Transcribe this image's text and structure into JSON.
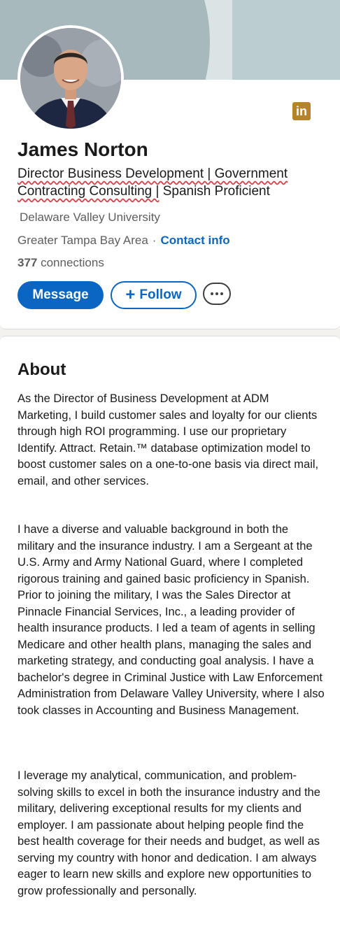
{
  "profile": {
    "name": "James Norton",
    "headline_part1": "Director Business Development | Government Contracting Consulting |",
    "headline_part2": " Spanish Proficient",
    "school": "Delaware Valley University",
    "location": "Greater Tampa Bay Area",
    "separator": "·",
    "contact_info": "Contact info",
    "connections_count": "377",
    "connections_label": " connections"
  },
  "actions": {
    "message": "Message",
    "follow_icon": "+",
    "follow": "Follow",
    "more_icon": "more-horizontal-icon"
  },
  "about": {
    "title": "About",
    "paragraphs": [
      "As the Director of Business Development at ADM Marketing, I build customer sales and loyalty for our clients through high ROI programming. I use our proprietary Identify. Attract. Retain.™ database optimization model to boost customer sales on a one-to-one basis via direct mail, email, and other services.",
      "I have a diverse and valuable background in both the military and the insurance industry. I am a Sergeant at the U.S. Army and Army National Guard, where I completed rigorous training and gained basic proficiency in Spanish. Prior to joining the military, I was the Sales Director at Pinnacle Financial Services, Inc., a leading provider of health insurance products. I led a team of agents in selling Medicare and other health plans, managing the sales and marketing strategy, and conducting goal analysis. I have a bachelor's degree in Criminal Justice with Law Enforcement Administration from Delaware Valley University, where I also took classes in Accounting and Business Management.",
      "I leverage my analytical, communication, and problem-solving skills to excel in both the insurance industry and the military, delivering exceptional results for my clients and employer. I am passionate about helping people find the best health coverage for their needs and budget, as well as serving my country with honor and dedication. I am always eager to learn new skills and explore new opportunities to grow professionally and personally."
    ]
  },
  "icons": {
    "linkedin": "linkedin-icon",
    "linkedin_glyph": "in"
  },
  "colors": {
    "brand_blue": "#0a66c2",
    "linkedin_badge": "#b7822c",
    "banner": "#a9bcbf"
  }
}
